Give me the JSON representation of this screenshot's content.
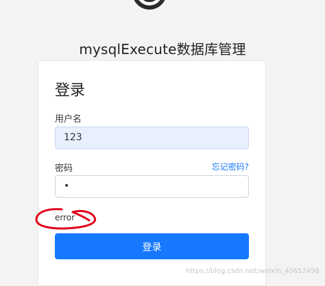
{
  "app_title": "mysqlExecute数据库管理",
  "login": {
    "title": "登录",
    "username_label": "用户名",
    "username_value": "123",
    "password_label": "密码",
    "password_value": "•",
    "forgot_link": "忘记密码?",
    "error_text": "error",
    "submit_label": "登录"
  },
  "watermark": "https://blog.csdn.net/weixin_40652498",
  "colors": {
    "primary": "#1677ff",
    "annotation": "#e0001a",
    "autofill_bg": "#e8f0fe"
  }
}
